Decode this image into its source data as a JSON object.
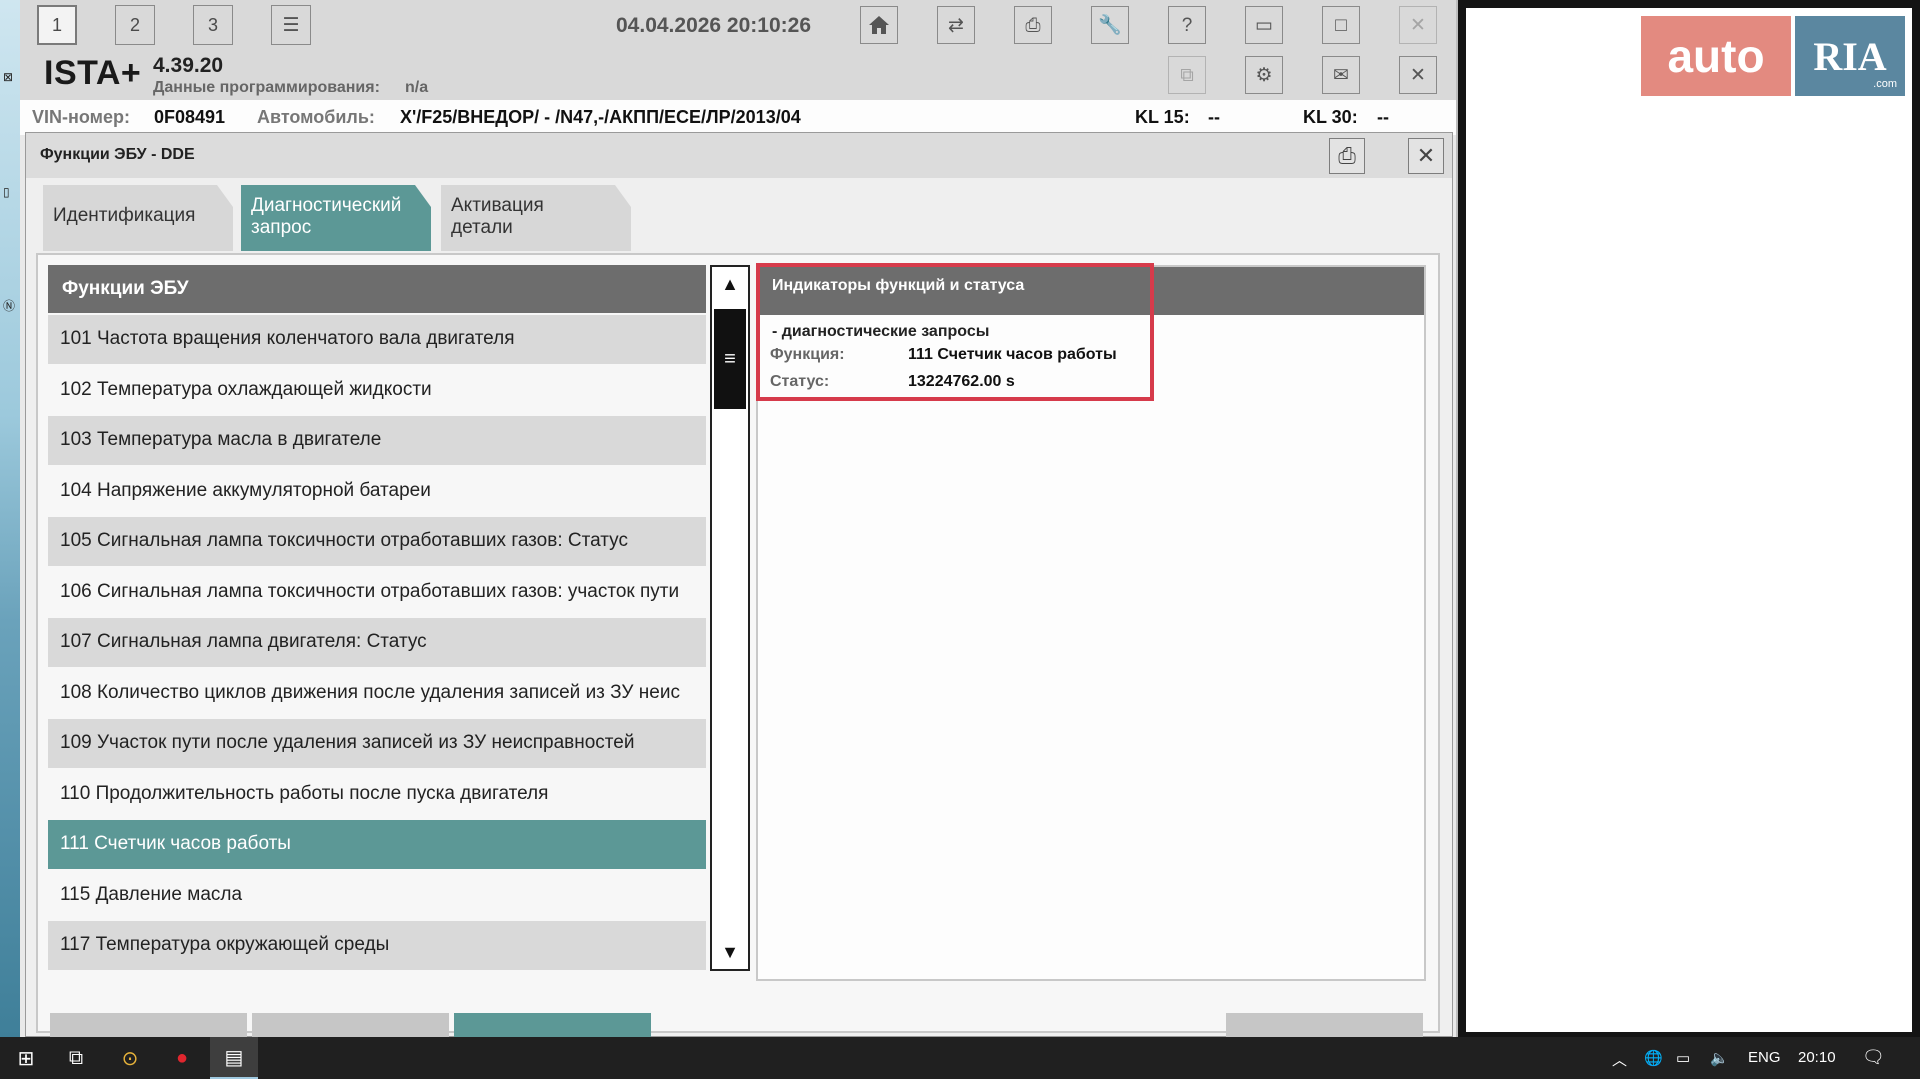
{
  "toolbar": {
    "datetime": "04.04.2026 20:10:26",
    "session_tabs": [
      "1",
      "2",
      "3"
    ]
  },
  "app": {
    "name": "ISTA+",
    "version": "4.39.20",
    "programming_label": "Данные программирования:",
    "programming_value": "n/a"
  },
  "vehicle": {
    "vin_label": "VIN-номер:",
    "vin_value": "0F08491",
    "car_label": "Автомобиль:",
    "car_value": "X'/F25/ВНЕДОР/ - /N47,-/АКПП/ЕСЕ/ЛР/2013/04",
    "kl15_label": "KL 15:",
    "kl15_value": "--",
    "kl30_label": "KL 30:",
    "kl30_value": "--"
  },
  "dialog": {
    "title": "Функции ЭБУ - DDE",
    "tabs": [
      {
        "line1": "Идентификация",
        "line2": ""
      },
      {
        "line1": "Диагностический",
        "line2": "запрос"
      },
      {
        "line1": "Активация",
        "line2": "детали"
      }
    ],
    "active_tab": 1
  },
  "functions": {
    "header": "Функции ЭБУ",
    "items": [
      "101 Частота вращения коленчатого вала двигателя",
      "102 Температура охлаждающей жидкости",
      "103 Температура масла в двигателе",
      "104 Напряжение аккумуляторной батареи",
      "105 Сигнальная лампа токсичности отработавших газов: Статус",
      "106 Сигнальная лампа токсичности отработавших газов: участок пути",
      "107 Сигнальная лампа двигателя: Статус",
      "108 Количество циклов движения после удаления записей из ЗУ неис",
      "109 Участок пути после удаления записей из ЗУ неисправностей",
      "110 Продолжительность работы после пуска двигателя",
      "111 Счетчик часов работы",
      "115 Давление масла",
      "117 Температура окружающей среды"
    ],
    "selected_index": 10
  },
  "status_panel": {
    "header": "Индикаторы функций и статуса",
    "subheader": "- диагностические запросы",
    "function_label": "Функция:",
    "function_value": "111 Счетчик часов работы",
    "status_label": "Статус:",
    "status_value": "13224762.00  s"
  },
  "logo": {
    "part1": "auto",
    "part2": "RIA",
    "suffix": ".com"
  },
  "taskbar": {
    "lang": "ENG",
    "time": "20:10"
  },
  "colors": {
    "accent_teal": "#5c9896",
    "highlight_red": "#d63b4b",
    "header_gray": "#6d6d6d"
  }
}
